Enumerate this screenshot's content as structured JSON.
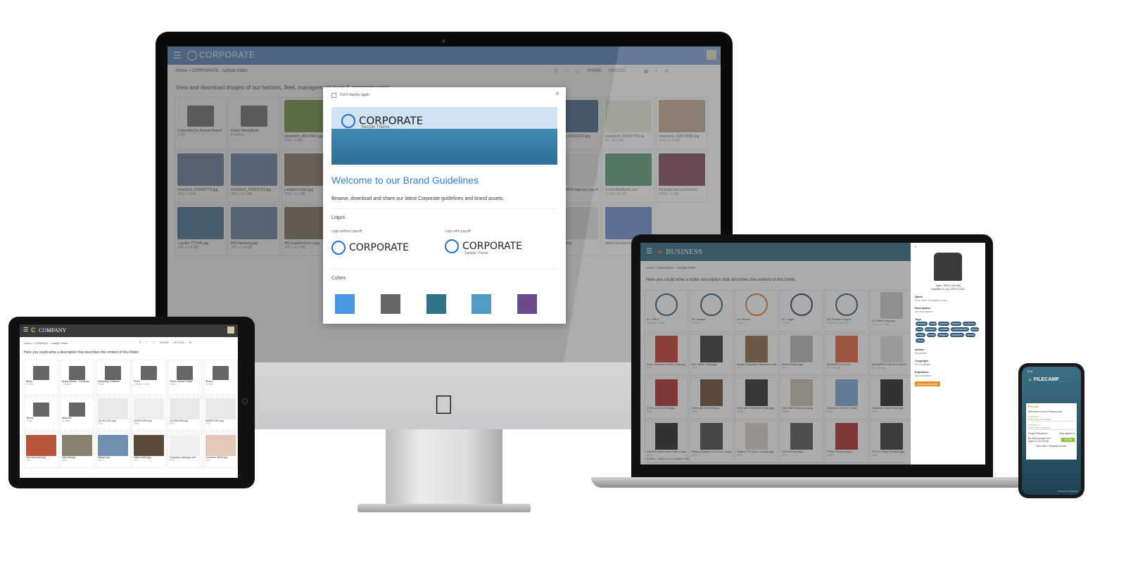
{
  "imac": {
    "app_title": "CORPORATE",
    "breadcrumb": "Home  >  CORPORATE - sample folder",
    "toolbar": {
      "share": "SHARE",
      "upload": "UPLOAD",
      "more": "···"
    },
    "description": "View and download images of our harbors, fleet, management team & corporate logos",
    "files": [
      {
        "name": "Corporate Inc Annual Report",
        "meta": "1 file",
        "type": "folder"
      },
      {
        "name": "Public MediaBank",
        "meta": "8 folders",
        "type": "folder"
      },
      {
        "name": "cleantech_45617541.jpg",
        "meta": "JPG • 3 MB",
        "color": "#6b8f3a"
      },
      {
        "name": "cleantech_58159323.jpg",
        "meta": "",
        "color": "#3d5f8a"
      },
      {
        "name": "cleantech_369097721.ai",
        "meta": "AI • 321 KB",
        "color": "#dde6d0"
      },
      {
        "name": "cleantech_418739590.jpg",
        "meta": "JPG • 1.6 MB",
        "color": "#a88660"
      },
      {
        "name": "cleantech_529456774.jpg",
        "meta": "JPG • 1 MB",
        "color": "#5e7796"
      },
      {
        "name": "cleantech_760321753.jpg",
        "meta": "JPG • 3.2 MB",
        "color": "#5f7ea6"
      },
      {
        "name": "container truck.jpg",
        "meta": "JPG • 3.7 MB",
        "color": "#8a6f5a"
      },
      {
        "name": "CORPORATE logo pos payoff",
        "meta": "",
        "color": "#eeeeee"
      },
      {
        "name": "Excel Workbook.xlsx",
        "meta": "XLSX • 25 KB",
        "color": "#1f7244"
      },
      {
        "name": "InDesign document.indd",
        "meta": "INDD • 1 MB",
        "color": "#49021f"
      },
      {
        "name": "Logistic-YT2041.jpg",
        "meta": "JPG • 2.4 MB",
        "color": "#3d6d96"
      },
      {
        "name": "MS-Hamburg.jpg",
        "meta": "JPG • 1.4 MB",
        "color": "#5d7da0"
      },
      {
        "name": "MS-Supplier2vo-ro.jpg",
        "meta": "JPG • 2.6 MB",
        "color": "#7d6a58"
      },
      {
        "name": "world le dwg",
        "meta": "",
        "color": "#dddddd"
      },
      {
        "name": "Word document.docx",
        "meta": "",
        "color": "#2b5bb5"
      }
    ],
    "apple_logo": "",
    "modal": {
      "dont_display": "Don't display again",
      "close": "×",
      "banner_logo": "CORPORATE",
      "banner_sub": "Sample Theme",
      "title": "Welcome to our Brand Guidelines",
      "subtitle": "Browse, download and share our latest Corporate guidelines and brand assets.",
      "logos_heading": "Logos",
      "logo1_label": "Logo without payoff",
      "logo2_label": "Logo with payoff",
      "logo_text": "CORPORATE",
      "logo_payoff": "Sample Theme",
      "colors_heading": "Colors",
      "colors": [
        "#4a94e4",
        "#666666",
        "#2f7285",
        "#4e9cc3",
        "#6a4a8c"
      ]
    }
  },
  "tablet": {
    "app_title": "COMPANY",
    "breadcrumb": "Home  >  COMPANY - sample folder",
    "toolbar": {
      "share": "SHARE",
      "upload": "UPLOAD"
    },
    "description": "Here you could write a description that describes the content of this folder.",
    "files": [
      {
        "name": "Bikes",
        "meta": "11 files",
        "type": "folder"
      },
      {
        "name": "Brand Assets - Company",
        "meta": "2 folders",
        "type": "folder"
      },
      {
        "name": "Marketing Collateral",
        "meta": "3 files",
        "type": "folder"
      },
      {
        "name": "PDFs",
        "meta": "1 folder, 2 files",
        "type": "folder"
      },
      {
        "name": "Public Upload Folder",
        "meta": "4 files",
        "type": "folder"
      },
      {
        "name": "Shoes",
        "meta": "26 files",
        "type": "folder"
      },
      {
        "name": "Tshirts",
        "meta": "4 files",
        "type": "folder"
      },
      {
        "name": "Watches",
        "meta": "11 files",
        "type": "folder"
      },
      {
        "name": "101410-001.png",
        "meta": "PNG",
        "color": "#e8e8e8"
      },
      {
        "name": "101910-001.png",
        "meta": "PNG",
        "color": "#eeeeee"
      },
      {
        "name": "101306-006.png",
        "meta": "PNG",
        "color": "#e8e8e8"
      },
      {
        "name": "606530-001.png",
        "meta": "PNG",
        "color": "#e8e8e8"
      },
      {
        "name": "bike advanced.jpg",
        "meta": "JPG",
        "color": "#b5553a"
      },
      {
        "name": "bike hills.jpg",
        "meta": "JPG",
        "color": "#8a8070"
      },
      {
        "name": "biking2.jpg",
        "meta": "JPG",
        "color": "#6d8fb0"
      },
      {
        "name": "biking roads.jpg",
        "meta": "JPG",
        "color": "#5c4a3a"
      },
      {
        "name": "Company catalogue.pdf",
        "meta": "PDF",
        "color": "#f0f0f0"
      },
      {
        "name": "Converse 35002.jpg",
        "meta": "JPG",
        "color": "#e2c8b8"
      }
    ]
  },
  "laptop": {
    "app_title": "BUSINESS",
    "breadcrumb": "Home  >  BUSINESS - sample folder",
    "description": "Here you could write a folder description that describes the content of this folder.",
    "footer": "36 items - sorted by name (folders first)",
    "files": [
      {
        "name": "01. PDFs",
        "meta": "1 folder, 3 files",
        "type": "circle",
        "ring": "#2d5a7c"
      },
      {
        "name": "02. Images",
        "meta": "26 files",
        "type": "circle",
        "ring": "#2d5a7c"
      },
      {
        "name": "03. Videos",
        "meta": "3 files",
        "type": "circle",
        "ring": "#e07a2a"
      },
      {
        "name": "04. Logos",
        "meta": "3 files",
        "type": "circle",
        "ring": "#2d3a6c"
      },
      {
        "name": "05. Product images",
        "meta": "3 folders, 20 files",
        "type": "circle",
        "ring": "#2d5a7c"
      },
      {
        "name": "AJ Table Lamp.jpg",
        "meta": "JPG • 3.4 KB",
        "color": "#cccccc"
      },
      {
        "name": "Arne Jacobsen Swan Chair.jpg",
        "meta": "JPG",
        "color": "#c43a2a"
      },
      {
        "name": "BL2 Table Lamp.jpg",
        "meta": "JPG",
        "color": "#333333"
      },
      {
        "name": "Borge Mogensen Spanish Chair",
        "meta": "JPG",
        "color": "#8a6a45"
      },
      {
        "name": "Bulb pendant.jpg",
        "meta": "JPG",
        "color": "#bbbbbb"
      },
      {
        "name": "BUSINESS icon.ai",
        "meta": "AI • 79 KB",
        "color": "#e5623a"
      },
      {
        "name": "BUSINESS logo pos payoff",
        "meta": "AI • 79 KB",
        "color": "#dddddd"
      },
      {
        "name": "CJ 5 Corona Chair.jpg",
        "meta": "JPG",
        "color": "#b02a2a"
      },
      {
        "name": "Finn Juhl 45 Chair.jpg",
        "meta": "JPG",
        "color": "#6a4a30"
      },
      {
        "name": "Finn Juhl Chieftains Chair.jpg",
        "meta": "JPEG",
        "color": "#2a2a2a"
      },
      {
        "name": "Finn Juhl Sideboard.jpeg",
        "meta": "JPEG",
        "color": "#c8c0b0"
      },
      {
        "name": "Jacobsen Series 7 Chair",
        "meta": "JPG",
        "color": "#7aa8d8"
      },
      {
        "name": "Jacobsen Swan Sofa.jpg",
        "meta": "JPG",
        "color": "#222222"
      },
      {
        "name": "KAISER idell Luxus Table Lamp",
        "meta": "JPG",
        "color": "#222222"
      },
      {
        "name": "Panton System 123 Low Lounge",
        "meta": "JPG",
        "color": "#444444"
      },
      {
        "name": "Panton VP Globe - Acrylic.jpg",
        "meta": "JPG",
        "color": "#d8d0c8"
      },
      {
        "name": "PH5 pendant.jpg",
        "meta": "JPG",
        "color": "#555555"
      },
      {
        "name": "PH50 Pendant.jpeg",
        "meta": "JPEG",
        "color": "#b02a2a"
      },
      {
        "name": "PH 3.2 Glass Pendant.jpg",
        "meta": "JPG",
        "color": "#333333"
      }
    ],
    "panel": {
      "close": "×",
      "type": "Type: JPEG (34 KB)",
      "modified": "Modified 5 Jun 2023 13:34",
      "name_label": "Name",
      "name_value": "Finn Juhl Chieftains Chair",
      "description_label": "Description",
      "description_value": "No description",
      "tags_label": "Tags",
      "tags": [
        "furniture",
        "chair",
        "comfort",
        "leather",
        "no person",
        "seat",
        "armchair",
        "cushion",
        "contemporary",
        "wood",
        "empty",
        "trendy",
        "elegant",
        "upholstery",
        "classic",
        "luxury"
      ],
      "author_label": "Author",
      "author_value": "No author",
      "copyright_label": "Copyright",
      "copyright_value": "No copyright",
      "expiration_label": "Expiration",
      "expiration_value": "No expiration",
      "campaign": "Spring campaign"
    }
  },
  "phone": {
    "time": "9:41",
    "brand": "FILECAMP",
    "login_title": "Filecamp",
    "welcome": "Welcome to your Filecamp trial",
    "username_label": "Username *",
    "username_placeholder": "Enter your username",
    "password_label": "Password *",
    "password_placeholder": "Enter your password",
    "forgot": "Forgot Password?",
    "stay_signed": "Stay signed in",
    "terms": "By clicking login you agree to our Terms",
    "login_button": "LOGIN",
    "new_user": "New user? Request Access",
    "powered": "Powered by Filecamp"
  }
}
